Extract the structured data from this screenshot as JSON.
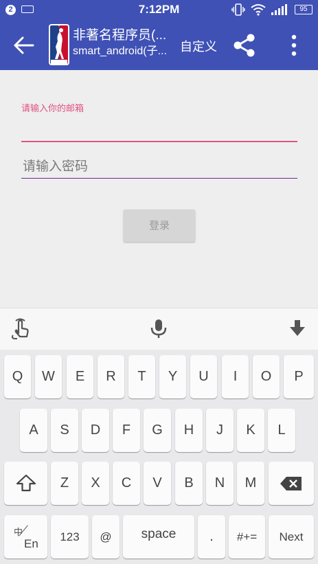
{
  "status_bar": {
    "notification_count": "2",
    "time": "7:12PM",
    "battery": "95"
  },
  "app_bar": {
    "title": "非著名程序员(...",
    "subtitle": "smart_android(子...",
    "custom_action": "自定义"
  },
  "form": {
    "email_label": "请输入你的邮箱",
    "password_placeholder": "请输入密码",
    "login_button": "登录"
  },
  "keyboard": {
    "row1": [
      "Q",
      "W",
      "E",
      "R",
      "T",
      "Y",
      "U",
      "I",
      "O",
      "P"
    ],
    "row2": [
      "A",
      "S",
      "D",
      "F",
      "G",
      "H",
      "J",
      "K",
      "L"
    ],
    "row3": [
      "Z",
      "X",
      "C",
      "V",
      "B",
      "N",
      "M"
    ],
    "lang_top": "中",
    "lang_bottom": "En",
    "numbers_key": "123",
    "at_key": "@",
    "space_key": "space",
    "period_key": ".",
    "symbols_key": "#+=",
    "next_key": "Next"
  },
  "colors": {
    "primary": "#3f51b5",
    "accent_pink": "#e05283",
    "background": "#eeeeee"
  },
  "icons": [
    "back-arrow-icon",
    "nba-logo",
    "share-icon",
    "more-vert-icon",
    "gesture-icon",
    "mic-icon",
    "hide-keyboard-icon",
    "shift-icon",
    "backspace-icon"
  ]
}
